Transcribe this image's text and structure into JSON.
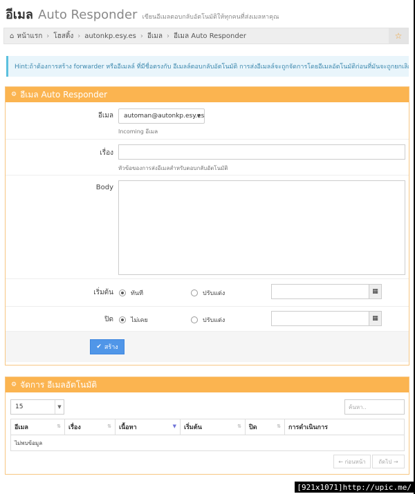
{
  "header": {
    "title_bold": "อีเมล",
    "title_light": "Auto Responder",
    "subtitle": "เขียนอีเมลตอบกลับอัตโนมัติให้ทุกคนที่ส่งเมลหาคุณ"
  },
  "breadcrumb": {
    "home_icon": "home-icon",
    "items": [
      "หน้าแรก",
      "โฮสติ้ง",
      "autonkp.esy.es",
      "อีเมล",
      "อีเมล Auto Responder"
    ],
    "star_icon": "star-icon"
  },
  "hint": "Hint:ถ้าต้องการสร้าง forwarder หรืออีเมลล์ ที่มีชื่อตรงกับ อีเมลล์ตอบกลับอัตโนมัติ การส่งอีเมลล์จะถูกจัดการโดยอีเมลอัตโนมัติก่อนที่มันจะถูกยกเลิก",
  "form": {
    "panel_title": "อีเมล Auto Responder",
    "email_label": "อีเมล",
    "email_value": "automan@autonkp.esy.es",
    "email_help": "Incoming อีเมล",
    "subject_label": "เรื่อง",
    "subject_value": "",
    "subject_help": "หัวข้อของการส่งอีเมลสำหรับตอบกลับอัตโนมัติ",
    "body_label": "Body",
    "body_value": "",
    "start_label": "เริ่มต้น",
    "start_opt_now": "ทันที",
    "start_opt_custom": "ปรับแต่ง",
    "start_selected": "ทันที",
    "end_label": "ปิด",
    "end_opt_never": "ไม่เคย",
    "end_opt_custom": "ปรับแต่ง",
    "end_selected": "ไม่เคย",
    "create_button": "สร้าง"
  },
  "manage": {
    "panel_title": "จัดการ อีเมลอัตโนมัติ",
    "page_length": "15",
    "search_placeholder": "ค้นหา..",
    "columns": [
      "อีเมล",
      "เรื่อง",
      "เนื้อหา",
      "เริ่มต้น",
      "ปิด",
      "การดำเนินการ"
    ],
    "sorted_column": "เนื้อหา",
    "empty_text": "ไม่พบข้อมูล",
    "prev_label": "← ก่อนหน้า",
    "next_label": "ถัดไป →"
  },
  "watermark": "[921x1071]http://upic.me/",
  "colors": {
    "panel_header": "#fbb450",
    "primary_button": "#5096e8",
    "hint_bg": "#e9f5fb"
  }
}
